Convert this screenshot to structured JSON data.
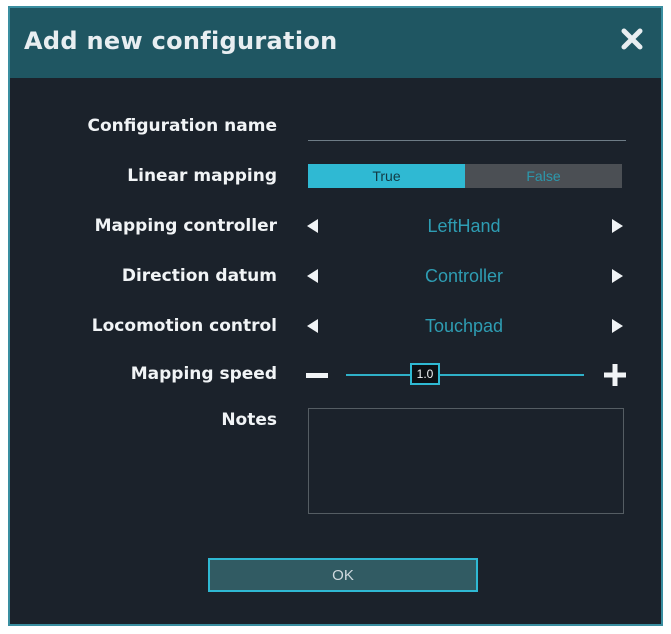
{
  "dialog": {
    "title": "Add new configuration",
    "close_icon": "close-icon"
  },
  "form": {
    "configuration_name": {
      "label": "Configuration name",
      "value": ""
    },
    "linear_mapping": {
      "label": "Linear mapping",
      "options": [
        "True",
        "False"
      ],
      "selected": "True"
    },
    "mapping_controller": {
      "label": "Mapping controller",
      "value": "LeftHand"
    },
    "direction_datum": {
      "label": "Direction datum",
      "value": "Controller"
    },
    "locomotion_control": {
      "label": "Locomotion control",
      "value": "Touchpad"
    },
    "mapping_speed": {
      "label": "Mapping speed",
      "value": "1.0"
    },
    "notes": {
      "label": "Notes",
      "value": ""
    }
  },
  "buttons": {
    "ok": "OK"
  },
  "colors": {
    "accent": "#2fb9d3",
    "title_bar": "#1f5662",
    "background": "#1b222b",
    "value_text": "#2e9db3"
  }
}
